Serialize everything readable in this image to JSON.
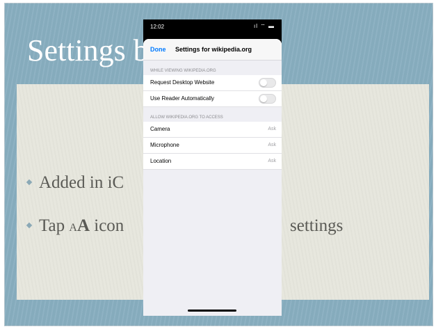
{
  "slide": {
    "title": "Settings b",
    "bullets": [
      {
        "text_before": "Added in iC",
        "text_after": ""
      },
      {
        "text_before": "Tap ",
        "small_a": "A",
        "bold_a": "A",
        "text_mid": " icon",
        "text_after": "settings"
      }
    ]
  },
  "phone": {
    "status": {
      "time": "12:02",
      "icons": "ıl ⌔ ▬"
    },
    "nav": {
      "done_label": "Done",
      "title": "Settings for wikipedia.org"
    },
    "sections": [
      {
        "header": "WHILE VIEWING WIKIPEDIA.ORG",
        "rows": [
          {
            "label": "Request Desktop Website",
            "toggle": false
          },
          {
            "label": "Use Reader Automatically",
            "toggle": false
          }
        ]
      },
      {
        "header": "ALLOW WIKIPEDIA.ORG TO ACCESS",
        "rows": [
          {
            "label": "Camera",
            "value": "Ask"
          },
          {
            "label": "Microphone",
            "value": "Ask"
          },
          {
            "label": "Location",
            "value": "Ask"
          }
        ]
      }
    ]
  },
  "colors": {
    "slide_bg": "#88aec0",
    "panel_bg": "#e6e6dc",
    "accent_link": "#007aff"
  }
}
